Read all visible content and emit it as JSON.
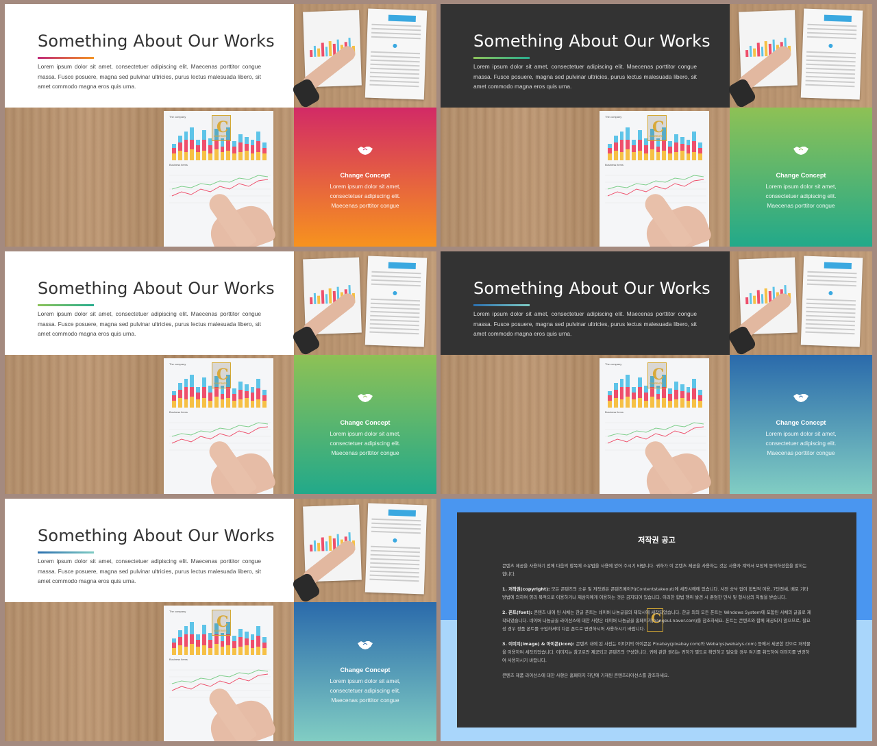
{
  "slides": [
    {
      "theme": "light",
      "title": "Something About Our Works",
      "accent": [
        "#c02c7a",
        "#f39323"
      ],
      "grad_top": "#d22a66",
      "grad_bottom": "#f7931e"
    },
    {
      "theme": "dark",
      "title": "Something About Our Works",
      "accent": [
        "#8dc35a",
        "#2aae8f"
      ],
      "grad_top": "#8ec155",
      "grad_bottom": "#22a98a"
    },
    {
      "theme": "light",
      "title": "Something About Our Works",
      "accent": [
        "#8dc35a",
        "#2aae8f"
      ],
      "grad_top": "#8ec155",
      "grad_bottom": "#22a98a"
    },
    {
      "theme": "dark",
      "title": "Something About Our Works",
      "accent": [
        "#2b6fae",
        "#7ecbc3"
      ],
      "grad_top": "#2a6aab",
      "grad_bottom": "#81cdc3"
    },
    {
      "theme": "light",
      "title": "Something About Our Works",
      "accent": [
        "#2b6fae",
        "#7ecbc3"
      ],
      "grad_top": "#2a6aab",
      "grad_bottom": "#81cdc3"
    }
  ],
  "common": {
    "description": "Lorem ipsum dolor sit amet, consectetuer adipiscing elit. Maecenas porttitor congue massa. Fusce posuere, magna sed pulvinar ultricies, purus lectus malesuada libero, sit amet commodo magna eros quis urna.",
    "concept_title": "Change Concept",
    "concept_line1": "Lorem ipsum dolor sit amet,",
    "concept_line2": "consectetuer adipiscing  elit.",
    "concept_line3": "Maecenas porttitor congue",
    "icon": "handshake-icon",
    "paper_label": "The company",
    "paper_label2": "Business items",
    "logo_letter": "C",
    "logo_text": "CONTENTS"
  },
  "notice": {
    "title": "저작권 공고",
    "p0": "콘텐츠 제공을 사용하기 전에 다음의 항목에 소유법을 사용에 얻어 주시기 바랍니다. 귀하가 이 콘텐츠 제공을 사용하는 것은 사용자 계약서 보장에 동의하셨음을 말하는 합니다.",
    "p1_head": "1. 저작권(copyright):",
    "p1": " 모든 콘텐츠의 소유 및 저작권은 콘텐츠메이커(Contentstakeout)에 세작시에에 있습니다. 사전 승낙 없이 합법적 이용, 7단전세, 배포 기타 방법에 의하여 영리 목적으로 이용하거나 제삼자에게 이용하는 것은 금지되어 있습니다. 이러한 합법 행위 발견 시 준엄한 민사 및 형사상의 처벌을 받습니다.",
    "p2_head": "2. 폰트(font):",
    "p2": " 콘텐츠 내에 된 서체는 한글 폰트는 네이버 나눔글꼴의 제작시에 세작되었습니다. 한글 외의 모든 폰트는 Windows System에 포함된 서체의 글꼴로 제작되었습니다. 네이버 나눔글꼴 라이선스에 대한 사항은 네이버 나눔글꼴 홈페이지(hangeul.naver.com)를 참조하세요. 폰트는 콘텐츠와 함께 제공되지 않으므로, 필요성 경우 정품 폰트를 구입하셔야 다른 폰트로 변경하시어 사용하시기 바랍니다.",
    "p3_head": "3. 이미지(image) & 아이콘(icon):",
    "p3": " 콘텐츠 내에 된 사진는 이미지의 아이콘은 Pixabay(pixabay.com)와 Webalys(webalys.com) 등에서 세공한 것으로 저작물을 이용하여 세작되었습니다. 이미지는 참고로만 제공되고 콘텐츠의 구성한니다. 귀에 관한 권리는 귀하가 별도로 확인하고 필요할 경우 여기를 취득하여 이미지를 변경하여 사용하시기 바랍니다.",
    "p4": "콘텐츠 제품 라이선스에 대한 사항은 홈페이지 하단에 기재된 콘텐츠라이선스를 참조하세요."
  }
}
